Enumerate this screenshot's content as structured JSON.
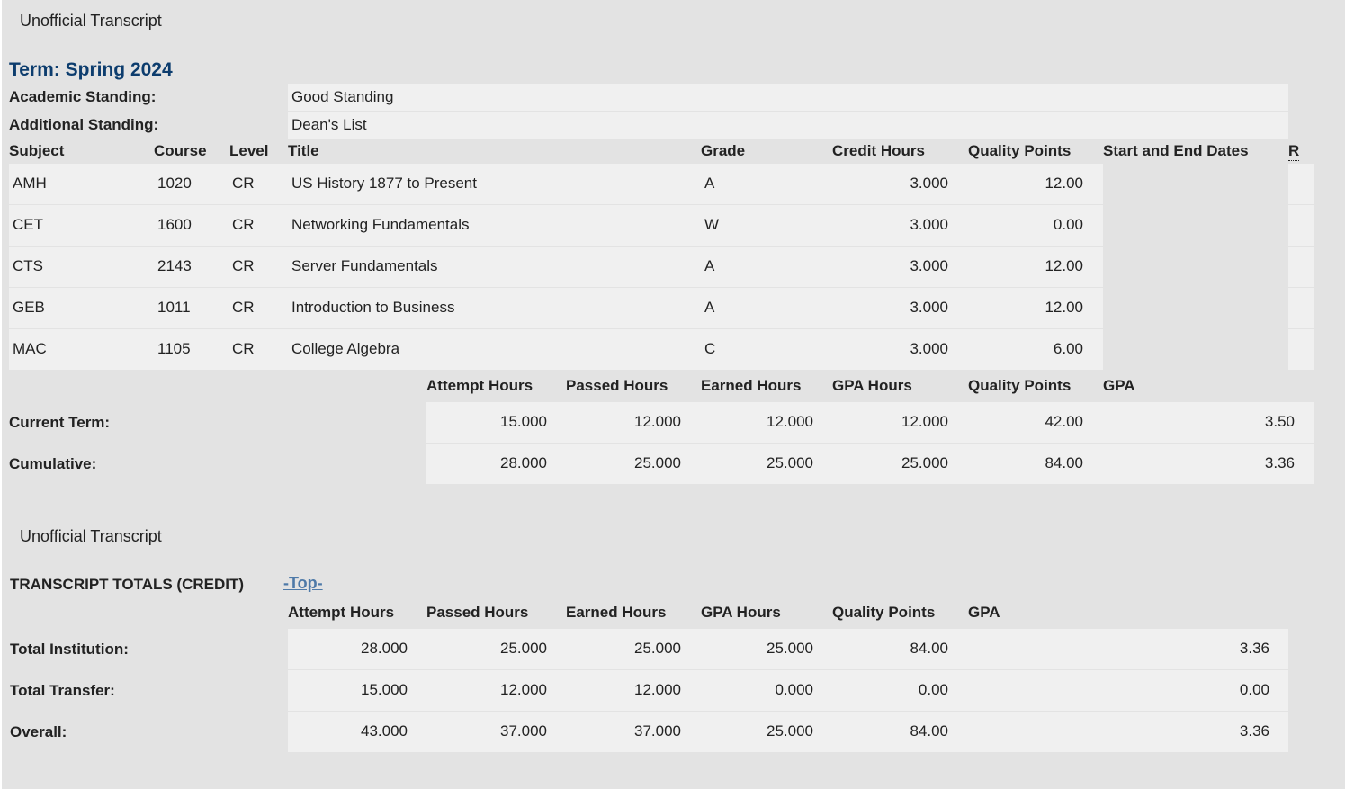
{
  "term_section": {
    "caption": "Unofficial Transcript",
    "term_title": "Term: Spring 2024",
    "academic_standing_label": "Academic Standing:",
    "academic_standing_value": "Good Standing",
    "additional_standing_label": "Additional Standing:",
    "additional_standing_value": "Dean's List",
    "course_headers": {
      "subject": "Subject",
      "course": "Course",
      "level": "Level",
      "title": "Title",
      "grade": "Grade",
      "credit_hours": "Credit Hours",
      "quality_points": "Quality Points",
      "dates": "Start and End Dates",
      "r": "R"
    },
    "courses": [
      {
        "subject": "AMH",
        "course": "1020",
        "level": "CR",
        "title": "US History 1877 to Present",
        "grade": "A",
        "credit_hours": "3.000",
        "quality_points": "12.00"
      },
      {
        "subject": "CET",
        "course": "1600",
        "level": "CR",
        "title": "Networking Fundamentals",
        "grade": "W",
        "credit_hours": "3.000",
        "quality_points": "0.00"
      },
      {
        "subject": "CTS",
        "course": "2143",
        "level": "CR",
        "title": "Server Fundamentals",
        "grade": "A",
        "credit_hours": "3.000",
        "quality_points": "12.00"
      },
      {
        "subject": "GEB",
        "course": "1011",
        "level": "CR",
        "title": "Introduction to Business",
        "grade": "A",
        "credit_hours": "3.000",
        "quality_points": "12.00"
      },
      {
        "subject": "MAC",
        "course": "1105",
        "level": "CR",
        "title": "College Algebra",
        "grade": "C",
        "credit_hours": "3.000",
        "quality_points": "6.00"
      }
    ],
    "totals_headers": {
      "attempt": "Attempt Hours",
      "passed": "Passed Hours",
      "earned": "Earned Hours",
      "gpa_hours": "GPA Hours",
      "quality_points": "Quality Points",
      "gpa": "GPA"
    },
    "totals": [
      {
        "label": "Current Term:",
        "attempt": "15.000",
        "passed": "12.000",
        "earned": "12.000",
        "gpa_hours": "12.000",
        "quality_points": "42.00",
        "gpa": "3.50"
      },
      {
        "label": "Cumulative:",
        "attempt": "28.000",
        "passed": "25.000",
        "earned": "25.000",
        "gpa_hours": "25.000",
        "quality_points": "84.00",
        "gpa": "3.36"
      }
    ]
  },
  "transcript_totals": {
    "caption": "Unofficial Transcript",
    "heading": "TRANSCRIPT TOTALS (CREDIT)",
    "top_link": "-Top-",
    "headers": {
      "attempt": "Attempt Hours",
      "passed": "Passed Hours",
      "earned": "Earned Hours",
      "gpa_hours": "GPA Hours",
      "quality_points": "Quality Points",
      "gpa": "GPA"
    },
    "rows": [
      {
        "label": "Total Institution:",
        "attempt": "28.000",
        "passed": "25.000",
        "earned": "25.000",
        "gpa_hours": "25.000",
        "quality_points": "84.00",
        "gpa": "3.36"
      },
      {
        "label": "Total Transfer:",
        "attempt": "15.000",
        "passed": "12.000",
        "earned": "12.000",
        "gpa_hours": "0.000",
        "quality_points": "0.00",
        "gpa": "0.00"
      },
      {
        "label": "Overall:",
        "attempt": "43.000",
        "passed": "37.000",
        "earned": "37.000",
        "gpa_hours": "25.000",
        "quality_points": "84.00",
        "gpa": "3.36"
      }
    ]
  }
}
